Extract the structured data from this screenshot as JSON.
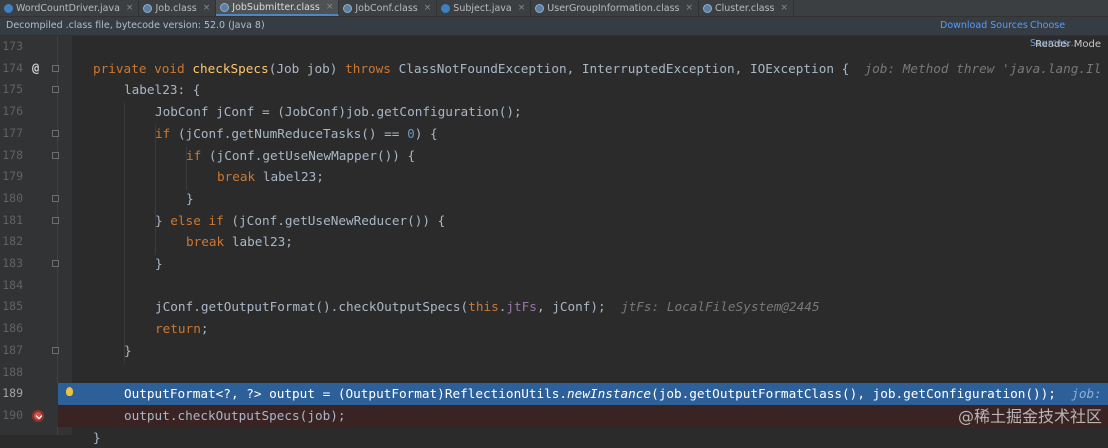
{
  "tabs": [
    {
      "label": "WordCountDriver.java",
      "type": "java"
    },
    {
      "label": "Job.class",
      "type": "class"
    },
    {
      "label": "JobSubmitter.class",
      "type": "class",
      "active": true
    },
    {
      "label": "JobConf.class",
      "type": "class"
    },
    {
      "label": "Subject.java",
      "type": "java"
    },
    {
      "label": "UserGroupInformation.class",
      "type": "class"
    },
    {
      "label": "Cluster.class",
      "type": "class"
    }
  ],
  "tab_close_glyph": "×",
  "infobar": {
    "message": "Decompiled .class file, bytecode version: 52.0 (Java 8)",
    "download_sources": "Download Sources",
    "choose_sources": "Choose Sources..."
  },
  "reader_mode": "Reader Mode",
  "gutter": {
    "line_numbers": [
      "173",
      "174",
      "175",
      "176",
      "177",
      "178",
      "179",
      "180",
      "181",
      "182",
      "183",
      "184",
      "185",
      "186",
      "187",
      "188",
      "189",
      "190"
    ],
    "method_marker": "@"
  },
  "code": {
    "l174": {
      "kw1": "private void ",
      "fn": "checkSpecs",
      "p1": "(Job job) ",
      "kw2": "throws",
      "p2": " ClassNotFoundException, InterruptedException, IOException {  ",
      "hint": "job: Method threw 'java.lang.Il"
    },
    "l175": {
      "text": "label23: {"
    },
    "l176": {
      "text": "JobConf jConf = (JobConf)job.getConfiguration();"
    },
    "l177": {
      "kw": "if",
      "p1": " (jConf.getNumReduceTasks() == ",
      "num": "0",
      "p2": ") {"
    },
    "l178": {
      "kw": "if",
      "p1": " (jConf.getUseNewMapper()) {"
    },
    "l179": {
      "kw": "break",
      "p1": " label23;"
    },
    "l180": {
      "text": "}"
    },
    "l181": {
      "p0": "} ",
      "kw": "else if",
      "p1": " (jConf.getUseNewReducer()) {"
    },
    "l182": {
      "kw": "break",
      "p1": " label23;"
    },
    "l183": {
      "text": "}"
    },
    "l185": {
      "p1": "jConf.getOutputFormat().checkOutputSpecs(",
      "kw": "this",
      "p2": ".",
      "fld": "jtFs",
      "p3": ", jConf);  ",
      "hint": "jtFs: LocalFileSystem@2445"
    },
    "l186": {
      "kw": "return",
      "p1": ";"
    },
    "l187": {
      "text": "}"
    },
    "l189": {
      "p1": "OutputFormat<?, ?> output = (OutputFormat)ReflectionUtils.",
      "it": "newInstance",
      "p2": "(job.getOutputFormatClass(), job.getConfiguration());  ",
      "hint": "job:"
    },
    "l190": {
      "text": "output.checkOutputSpecs(job);"
    },
    "l191": {
      "text": "}"
    }
  },
  "watermark": "@稀土掘金技术社区"
}
